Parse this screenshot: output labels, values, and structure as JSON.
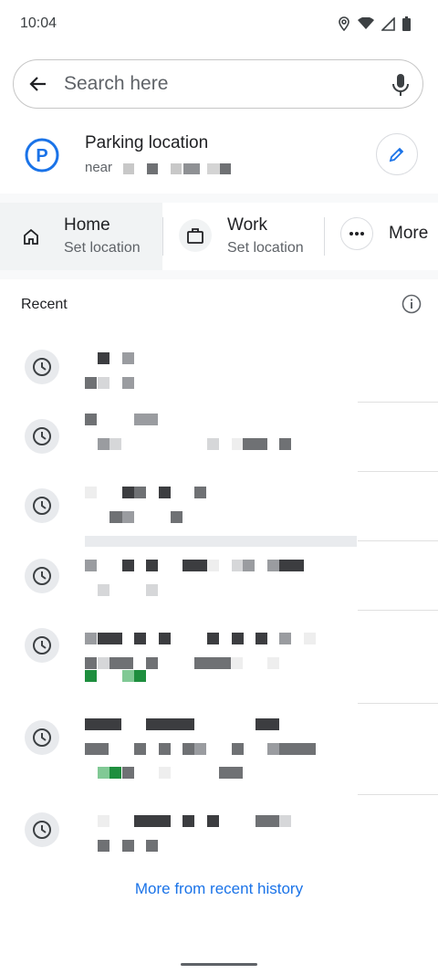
{
  "status_bar": {
    "time": "10:04"
  },
  "search": {
    "placeholder": "Search here"
  },
  "parking": {
    "title": "Parking location",
    "subtitle": "near"
  },
  "places": [
    {
      "title": "Home",
      "subtitle": "Set location"
    },
    {
      "title": "Work",
      "subtitle": "Set location"
    }
  ],
  "more_label": "More",
  "recent": {
    "title": "Recent",
    "more_link": "More from recent history"
  },
  "colors": {
    "accent": "#1a73e8",
    "icon": "#3c4043",
    "clock_bg": "#e8eaed"
  }
}
